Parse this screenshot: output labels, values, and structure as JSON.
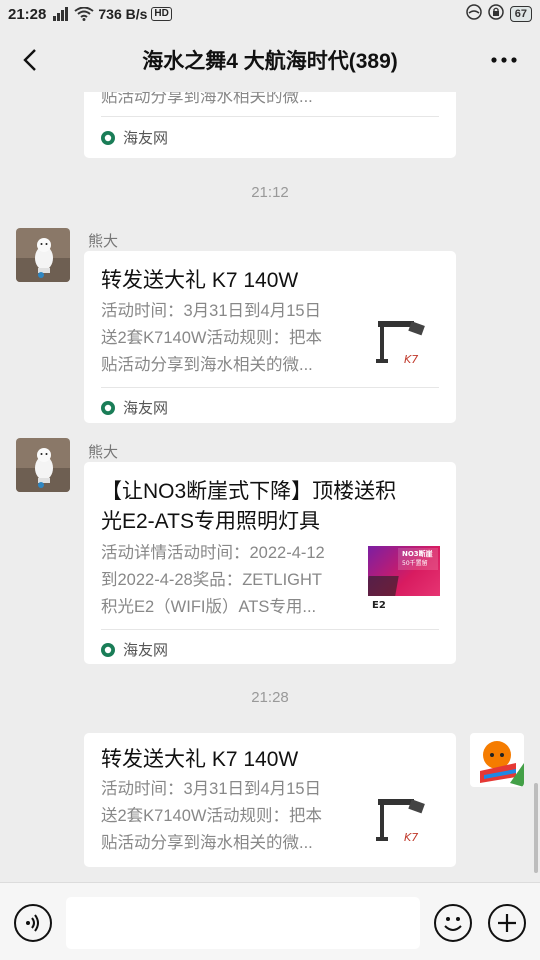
{
  "status_bar": {
    "time": "21:28",
    "network_speed": "736 B/s",
    "hd_label": "HD",
    "battery": "67"
  },
  "header": {
    "title": "海水之舞4 大航海时代(389)"
  },
  "messages": [
    {
      "type": "partial_card",
      "desc_line": "贴活动分享到海水相关的微...",
      "source": "海友网"
    },
    {
      "type": "timestamp",
      "text": "21:12"
    },
    {
      "type": "card",
      "sender": "熊大",
      "title": "转发送大礼 K7 140W",
      "desc": [
        "活动时间：3月31日到4月15日",
        "送2套K7140W活动规则：把本",
        "贴活动分享到海水相关的微..."
      ],
      "source": "海友网",
      "thumb_caption": "K7"
    },
    {
      "type": "card",
      "sender": "熊大",
      "title": [
        "【让NO3断崖式下降】顶楼送积",
        "光E2-ATS专用照明灯具"
      ],
      "desc": [
        "活动详情活动时间：2022-4-12",
        "到2022-4-28奖品：ZETLIGHT",
        "积光E2（WIFI版）ATS专用..."
      ],
      "source": "海友网",
      "thumb_text": [
        "NO3断崖",
        "50千置留",
        "E2"
      ]
    },
    {
      "type": "timestamp",
      "text": "21:28"
    },
    {
      "type": "card_sent",
      "title": "转发送大礼 K7 140W",
      "desc": [
        "活动时间：3月31日到4月15日",
        "送2套K7140W活动规则：把本",
        "贴活动分享到海水相关的微..."
      ]
    }
  ],
  "colors": {
    "background": "#ededed",
    "card": "#ffffff",
    "source_dot": "#1a7d57",
    "thumb_pink": "#c2185b"
  },
  "icons": [
    "back-icon",
    "more-icon",
    "voice-icon",
    "emoji-icon",
    "plus-icon",
    "wifi-icon",
    "signal-icon"
  ]
}
